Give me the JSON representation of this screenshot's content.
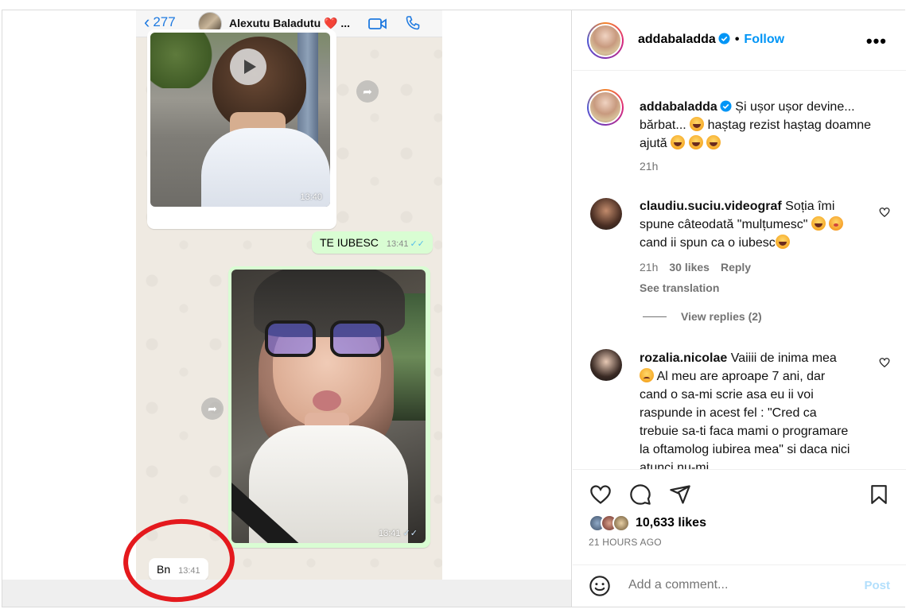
{
  "chat": {
    "back_count": "277",
    "contact_name": "Alexutu Baladutu ❤️ ...",
    "messages": [
      {
        "type": "video",
        "time": "13:40"
      },
      {
        "type": "text",
        "text": "TE IUBESC",
        "time": "13:41",
        "ticks": "✓✓"
      },
      {
        "type": "image",
        "time": "13:41",
        "ticks": "✓✓"
      },
      {
        "type": "text",
        "text": "Bn",
        "time": "13:41"
      }
    ]
  },
  "post": {
    "author": "addabaladda",
    "separator": "•",
    "follow_label": "Follow",
    "more_label": "•••",
    "caption": {
      "username": "addabaladda",
      "text_part1": "Și ușor ușor devine... bărbat... ",
      "text_part2": " haștag rezist haștag doamne ajută ",
      "time": "21h"
    },
    "comments": [
      {
        "username": "claudiu.suciu.videograf",
        "text_part1": "Soția îmi spune câteodată \"mulțumesc\" ",
        "text_part2": " cand ii spun ca o iubesc",
        "time": "21h",
        "likes": "30 likes",
        "reply": "Reply",
        "translation": "See translation",
        "view_replies": "View replies (2)"
      },
      {
        "username": "rozalia.nicolae",
        "text_part1": "Vaiiii de inima mea ",
        "text_part2": " Al meu are aproape 7 ani, dar cand o sa-mi scrie asa eu ii voi raspunde in acest fel : \"Cred ca trebuie sa-ti faca mami o programare la oftamolog iubirea mea\" si daca nici atunci nu-mi"
      }
    ],
    "likes_count": "10,633 likes",
    "posted_ago": "21 HOURS AGO",
    "add_comment_placeholder": "Add a comment...",
    "post_label": "Post"
  },
  "colors": {
    "accent_blue": "#0095f6",
    "wa_out_bubble": "#d9fdd3",
    "wa_tick_blue": "#53bdeb",
    "red_circle": "#e4191d"
  },
  "icons": [
    "chevron-left-icon",
    "video-call-icon",
    "phone-icon",
    "play-icon",
    "forward-icon",
    "verified-badge-icon",
    "more-options-icon",
    "heart-icon",
    "comment-icon",
    "share-icon",
    "bookmark-icon",
    "emoji-icon"
  ]
}
